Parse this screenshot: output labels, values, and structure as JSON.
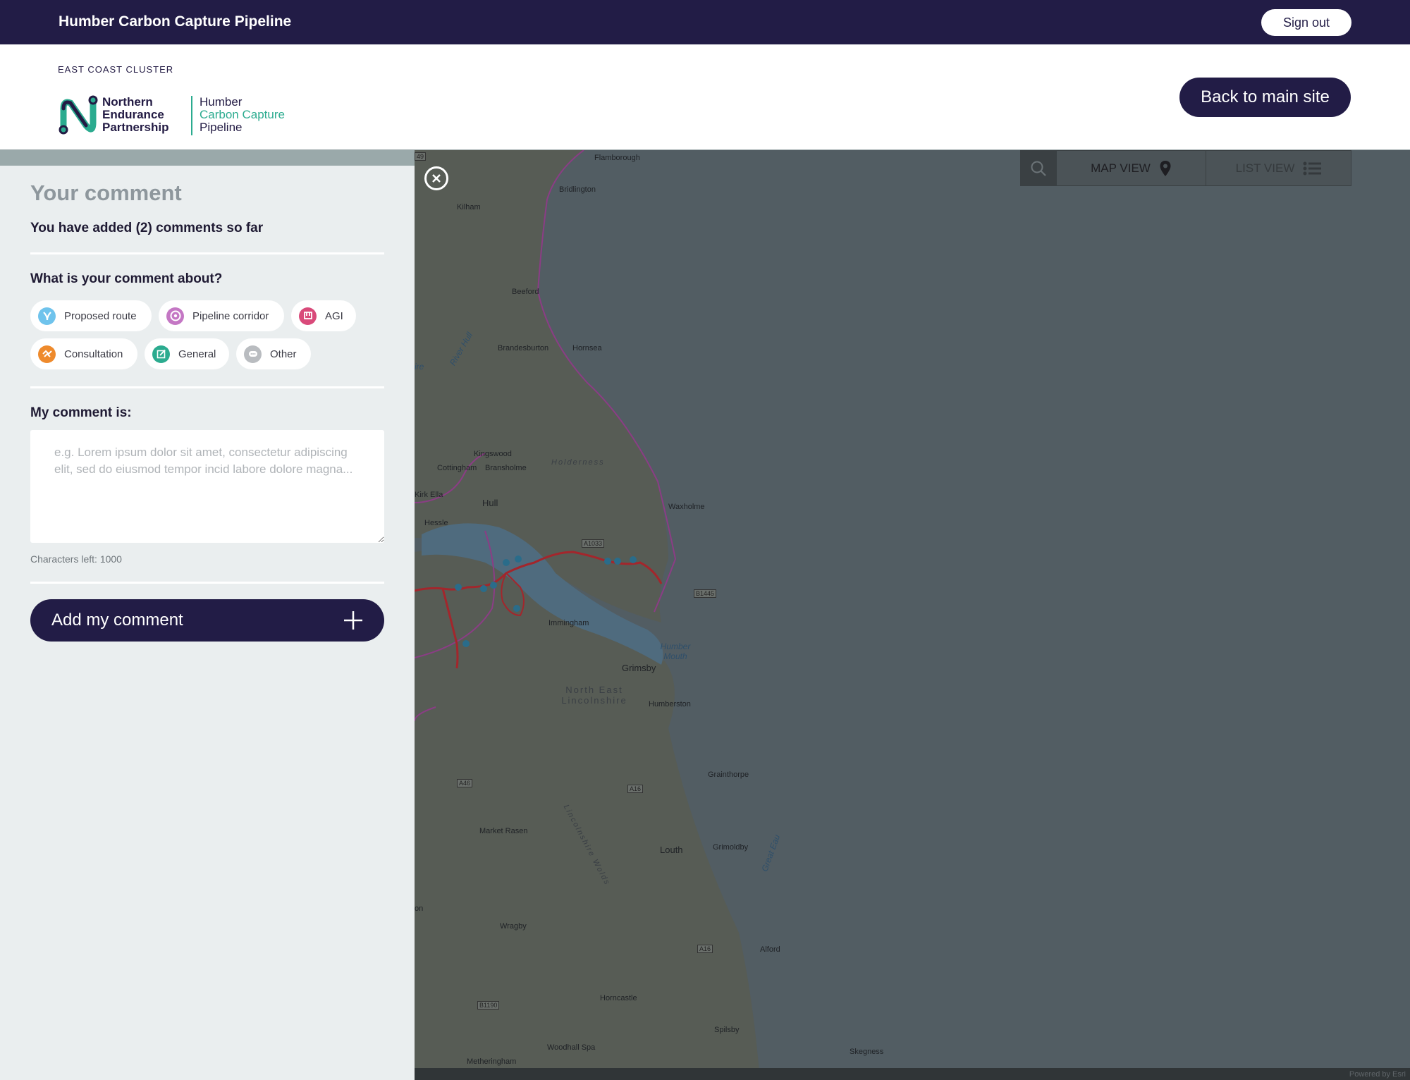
{
  "topbar": {
    "title": "Humber Carbon Capture Pipeline",
    "signout_label": "Sign out"
  },
  "header": {
    "ecc_logo_text": "EAST COAST CLUSTER",
    "nep_lines": [
      "Northern",
      "Endurance",
      "Partnership"
    ],
    "hccp_lines": [
      "Humber",
      "Carbon Capture",
      "Pipeline"
    ],
    "back_label": "Back to main site"
  },
  "sidebar": {
    "heading": "Your comment",
    "count_text": "You have added (2) comments so far",
    "about_label": "What is your comment about?",
    "categories": [
      {
        "label": "Proposed route",
        "icon": "route-icon",
        "color": "#6fc3ec"
      },
      {
        "label": "Pipeline corridor",
        "icon": "corridor-icon",
        "color": "#c477c4"
      },
      {
        "label": "AGI",
        "icon": "agi-icon",
        "color": "#d94a7a"
      },
      {
        "label": "Consultation",
        "icon": "consultation-icon",
        "color": "#ee8a2c"
      },
      {
        "label": "General",
        "icon": "general-icon",
        "color": "#2bab8f"
      },
      {
        "label": "Other",
        "icon": "other-icon",
        "color": "#b9bcc0"
      }
    ],
    "comment_label": "My comment is:",
    "comment_placeholder": "e.g. Lorem ipsum dolor sit amet, consectetur adipiscing elit, sed do eiusmod tempor incid labore dolore magna...",
    "chars_left": "Characters left: 1000",
    "add_label": "Add my comment"
  },
  "map": {
    "toolbar": {
      "map_view_label": "MAP VIEW",
      "list_view_label": "LIST VIEW"
    },
    "attribution": "Powered by Esri",
    "places": {
      "flamborough": "Flamborough",
      "bridlington": "Bridlington",
      "kilham": "Kilham",
      "beeford": "Beeford",
      "brandesburton": "Brandesburton",
      "hornsea": "Hornsea",
      "kingswood": "Kingswood",
      "cottingham": "Cottingham",
      "bransholme": "Bransholme",
      "holderness": "Holderness",
      "kirk_ella": "Kirk Ella",
      "hull": "Hull",
      "hessle": "Hessle",
      "waxholme": "Waxholme",
      "immingham": "Immingham",
      "humber_mouth": "Humber Mouth",
      "grimsby": "Grimsby",
      "ne_lincs": "North East Lincolnshire",
      "humberston": "Humberston",
      "grainthorpe": "Grainthorpe",
      "lincs_wolds": "Lincolnshire Wolds",
      "market_rasen": "Market Rasen",
      "louth": "Louth",
      "grimoldby": "Grimoldby",
      "great_eau": "Great Eau",
      "wragby": "Wragby",
      "alford": "Alford",
      "horncastle": "Horncastle",
      "spilsby": "Spilsby",
      "woodhall_spa": "Woodhall Spa",
      "metheringham": "Metheringham",
      "skegness": "Skegness",
      "driffield_partial": "ire",
      "river_hull": "River Hull",
      "on_partial": "on"
    },
    "roads": {
      "a1033": "A1033",
      "b1445": "B1445",
      "a46": "A46",
      "a16a": "A16",
      "a16b": "A16",
      "b1190": "B1190",
      "a49": "49"
    }
  },
  "colors": {
    "navy": "#221c46",
    "teal": "#2bab8f",
    "route_red": "#b3262c",
    "boundary_purple": "#9b3e8f"
  }
}
